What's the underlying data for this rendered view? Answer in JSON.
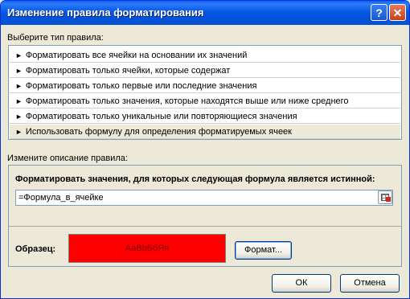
{
  "window": {
    "title": "Изменение правила форматирования",
    "help_label": "?",
    "close_label": "✕"
  },
  "rule_type": {
    "heading": "Выберите тип правила:",
    "items": [
      "Форматировать все ячейки на основании их значений",
      "Форматировать только ячейки, которые содержат",
      "Форматировать только первые или последние значения",
      "Форматировать только значения, которые находятся выше или ниже среднего",
      "Форматировать только уникальные или повторяющиеся значения",
      "Использовать формулу для определения форматируемых ячеек"
    ],
    "selected_index": 5,
    "bullet": "►"
  },
  "description": {
    "heading": "Измените описание правила:",
    "formula_label": "Форматировать значения, для которых следующая формула является истинной:",
    "formula_value": "=Формула_в_ячейке"
  },
  "preview": {
    "label": "Образец:",
    "sample_text": "АаВbБбЯя",
    "fill_color": "#ff0000"
  },
  "buttons": {
    "format": "Формат...",
    "ok": "ОК",
    "cancel": "Отмена"
  },
  "icons": {
    "help": "help-icon",
    "close": "close-icon",
    "range-select": "range-select-icon"
  }
}
